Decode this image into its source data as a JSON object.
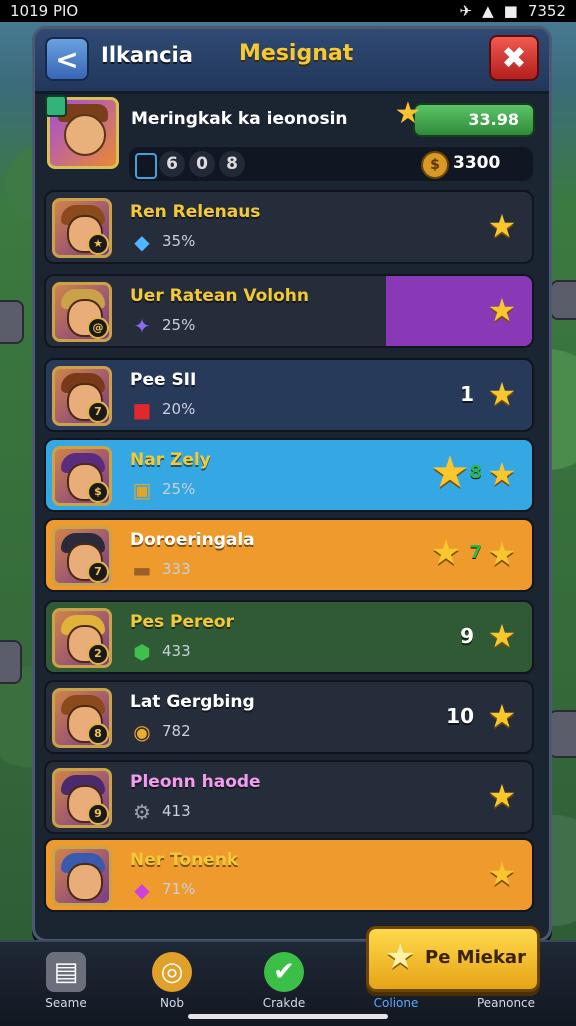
{
  "status_bar": {
    "time": "1019 PIO",
    "right_text": "7352"
  },
  "header": {
    "back_label": "<",
    "title": "Ilkancia",
    "center_title": "Mesignat",
    "close_label": "✖"
  },
  "summary": {
    "name": "Meringkak ka ieonosin",
    "xp_value": "33.98",
    "digits": [
      "6",
      "0",
      "8"
    ],
    "gold_value": "3300"
  },
  "rows": [
    {
      "name": "Ren Relenaus",
      "stat": "35%",
      "count": "",
      "level": "★",
      "name_color": "#f4c936",
      "icon": "diamond",
      "bg": "#262d3a"
    },
    {
      "name": "Uer Ratean Volohn",
      "stat": "25%",
      "count": "",
      "level": "@",
      "name_color": "#f4c936",
      "icon": "crystal",
      "bg": "#262d3a"
    },
    {
      "name": "Pee SII",
      "stat": "20%",
      "count": "1",
      "level": "7",
      "name_color": "#ffffff",
      "icon": "ruby",
      "bg": "#283a5a"
    },
    {
      "name": "Nar Zely",
      "stat": "25%",
      "count": "8",
      "level": "$",
      "name_color": "#f4c936",
      "icon": "scroll",
      "bg": "#35a8e3"
    },
    {
      "name": "Doroeringala",
      "stat": "333",
      "count": "7",
      "level": "7",
      "name_color": "#ffffff",
      "icon": "chest",
      "bg": "#ef9a2c"
    },
    {
      "name": "Pes Pereor",
      "stat": "433",
      "count": "9",
      "level": "2",
      "name_color": "#f4c936",
      "icon": "emerald",
      "bg": "#2f5a35"
    },
    {
      "name": "Lat Gergbing",
      "stat": "782",
      "count": "10",
      "level": "8",
      "name_color": "#ffffff",
      "icon": "coin",
      "bg": "#262d3a"
    },
    {
      "name": "Pleonn haode",
      "stat": "413",
      "count": "",
      "level": "9",
      "name_color": "#f39cf0",
      "icon": "gear",
      "bg": "#262d3a"
    },
    {
      "name": "Ner Tonenk",
      "stat": "71%",
      "count": "",
      "level": "",
      "name_color": "#f4c936",
      "icon": "amethyst",
      "bg": "#ef9a2c"
    }
  ],
  "cta": {
    "label": "Pe Miekar"
  },
  "tabs": [
    {
      "label": "Seame",
      "icon": "chest-icon"
    },
    {
      "label": "Nob",
      "icon": "target-icon"
    },
    {
      "label": "Crakde",
      "icon": "check-icon"
    },
    {
      "label": "Colione",
      "icon": "star-icon"
    },
    {
      "label": "Peanonce",
      "icon": "none"
    }
  ]
}
